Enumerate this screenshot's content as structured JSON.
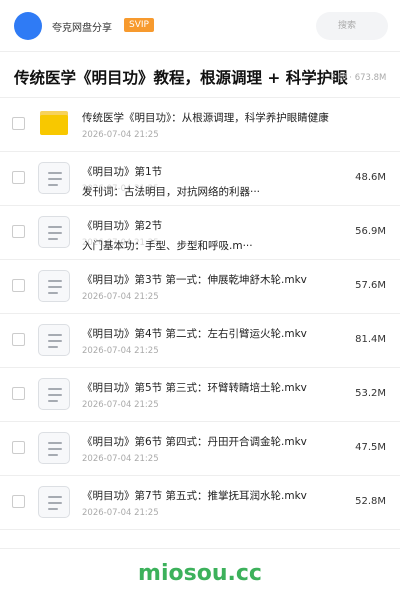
{
  "header": {
    "brand": "夸克网盘分享",
    "badge": "SVIP",
    "search_placeholder": "搜索"
  },
  "share": {
    "title": "传统医学《明目功》教程，根源调理 + 科学护眼",
    "meta": "2 项 · 673.8M"
  },
  "items": [
    {
      "type": "folder",
      "name": "传统医学《明目功》：从根源调理，科学养护眼睛健康",
      "date": "2026-07-04 21:25",
      "size": ""
    },
    {
      "type": "file",
      "name": "《明目功》第1节",
      "desc": "发刊词：古法明目，对抗网络的利器···",
      "date": "2026-07-04 21:25",
      "size": "48.6M"
    },
    {
      "type": "file",
      "name": "《明目功》第2节",
      "desc": "入门基本功：手型、步型和呼吸.m···",
      "date": "2026-07-04 21:25",
      "size": "56.9M"
    },
    {
      "type": "file",
      "name": "《明目功》第3节 第一式：伸展乾坤舒木轮.mkv",
      "date": "2026-07-04 21:25",
      "size": "57.6M"
    },
    {
      "type": "file",
      "name": "《明目功》第4节 第二式：左右引臂运火轮.mkv",
      "date": "2026-07-04 21:25",
      "size": "81.4M"
    },
    {
      "type": "file",
      "name": "《明目功》第5节 第三式：环臂转睛培土轮.mkv",
      "date": "2026-07-04 21:25",
      "size": "53.2M"
    },
    {
      "type": "file",
      "name": "《明目功》第6节 第四式：丹田开合调金轮.mkv",
      "date": "2026-07-04 21:25",
      "size": "47.5M"
    },
    {
      "type": "file",
      "name": "《明目功》第7节 第五式：推掌抚耳润水轮.mkv",
      "date": "2026-07-04 21:25",
      "size": "52.8M"
    }
  ],
  "footer": {
    "watermark": "miosou.cc"
  },
  "colors": {
    "accent": "#2f7bf5",
    "svip": "#f79a2e",
    "folder": "#f8c800",
    "watermark": "#3cb15b"
  }
}
